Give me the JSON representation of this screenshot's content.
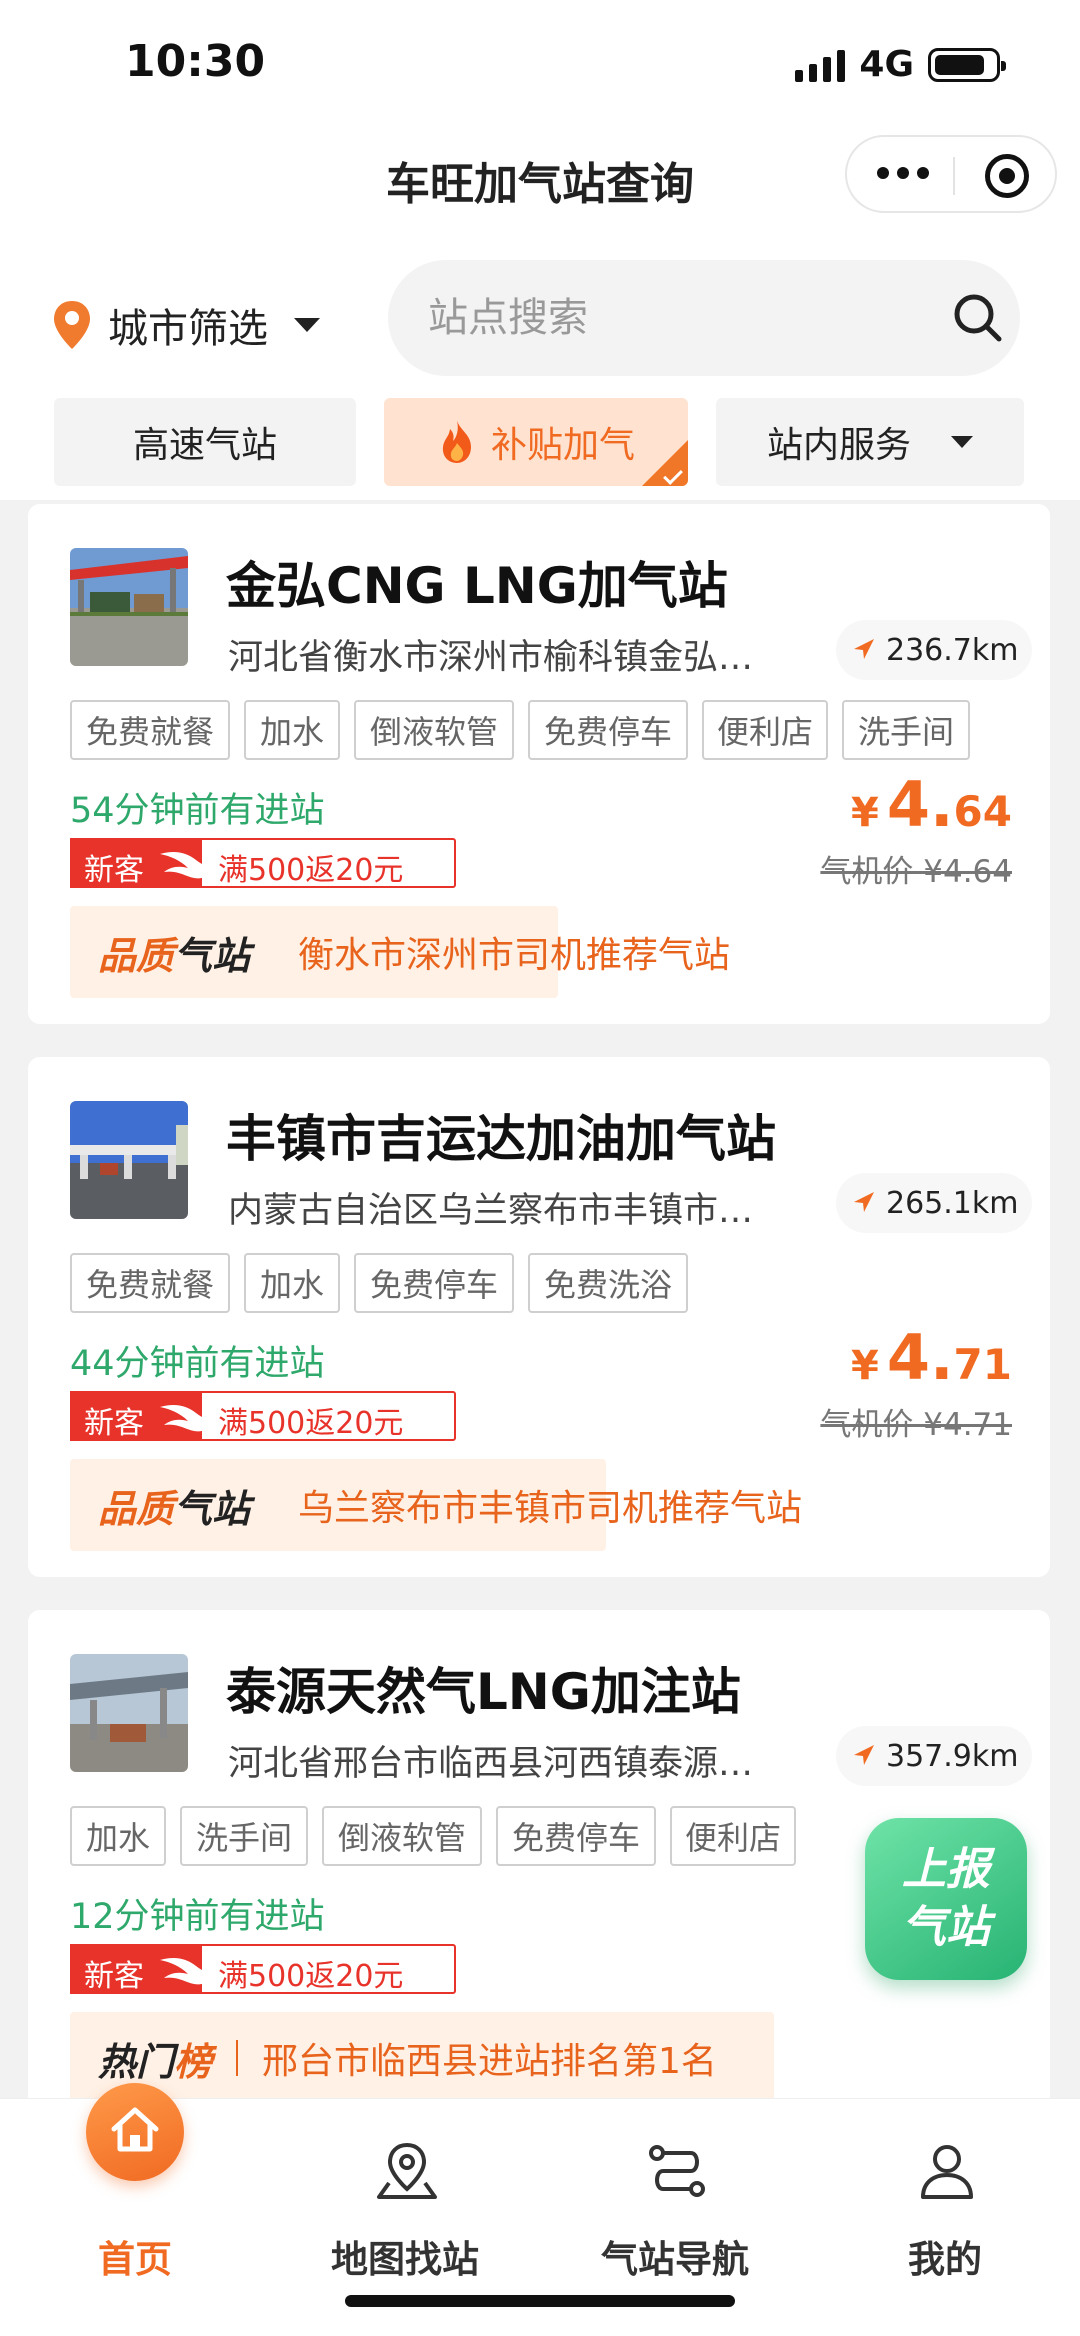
{
  "status_bar": {
    "time": "10:30",
    "network": "4G",
    "battery_level": 0.85
  },
  "nav": {
    "title": "车旺加气站查询"
  },
  "search": {
    "city_filter_label": "城市筛选",
    "placeholder": "站点搜索"
  },
  "filters": {
    "highway": "高速气站",
    "subsidy": "补贴加气",
    "service": "站内服务"
  },
  "stations": [
    {
      "name": "金弘CNG LNG加气站",
      "address": "河北省衡水市深州市榆科镇金弘…",
      "distance": "236.7km",
      "tags": [
        "免费就餐",
        "加水",
        "倒液软管",
        "免费停车",
        "便利店",
        "洗手间"
      ],
      "recent": "54分钟前有进站",
      "price_currency": "¥",
      "price_int": "4.",
      "price_dec": "64",
      "orig_price": "气机价 ¥4.64",
      "promo_new": "新客",
      "promo_text": "满500返20元",
      "badge_a": "品质",
      "badge_b": "气站",
      "badge_text": "衡水市深州市司机推荐气站"
    },
    {
      "name": "丰镇市吉运达加油加气站",
      "address": "内蒙古自治区乌兰察布市丰镇市…",
      "distance": "265.1km",
      "tags": [
        "免费就餐",
        "加水",
        "免费停车",
        "免费洗浴"
      ],
      "recent": "44分钟前有进站",
      "price_currency": "¥",
      "price_int": "4.",
      "price_dec": "71",
      "orig_price": "气机价 ¥4.71",
      "promo_new": "新客",
      "promo_text": "满500返20元",
      "badge_a": "品质",
      "badge_b": "气站",
      "badge_text": "乌兰察布市丰镇市司机推荐气站"
    },
    {
      "name": "泰源天然气LNG加注站",
      "address": "河北省邢台市临西县河西镇泰源…",
      "distance": "357.9km",
      "tags": [
        "加水",
        "洗手间",
        "倒液软管",
        "免费停车",
        "便利店"
      ],
      "recent": "12分钟前有进站",
      "promo_new": "新客",
      "promo_text": "满500返20元",
      "badge_a": "热门",
      "badge_b": "榜",
      "badge_text": "邢台市临西县进站排名第1名"
    }
  ],
  "report_button": {
    "line1": "上报",
    "line2": "气站"
  },
  "tabs": {
    "home": "首页",
    "map": "地图找站",
    "navigation": "气站导航",
    "mine": "我的"
  },
  "colors": {
    "accent": "#f06a22",
    "green": "#2ea86b",
    "promo_red": "#e8332b"
  }
}
